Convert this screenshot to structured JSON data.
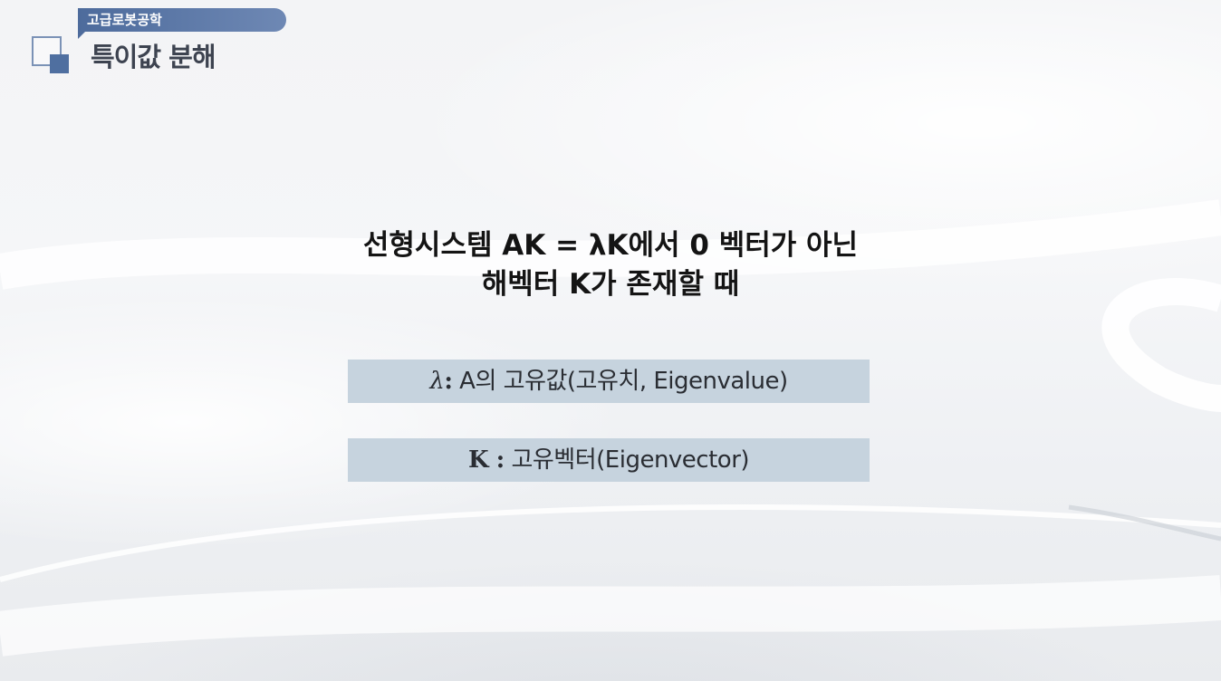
{
  "header": {
    "course_label": "고급로봇공학",
    "page_title": "특이값 분해"
  },
  "main": {
    "heading_line1": "선형시스템 AK = λK에서 0 벡터가 아닌",
    "heading_line2": "해벡터 K가 존재할 때",
    "definitions": [
      {
        "symbol": "λ",
        "separator": ":",
        "text": " A의 고유값(고유치, Eigenvalue)"
      },
      {
        "symbol": "K",
        "separator": " :",
        "text": " 고유벡터(Eigenvector)"
      }
    ]
  },
  "colors": {
    "accent": "#4f6fa0",
    "box_fill": "#c6d3de",
    "title_text": "#3d4350"
  }
}
